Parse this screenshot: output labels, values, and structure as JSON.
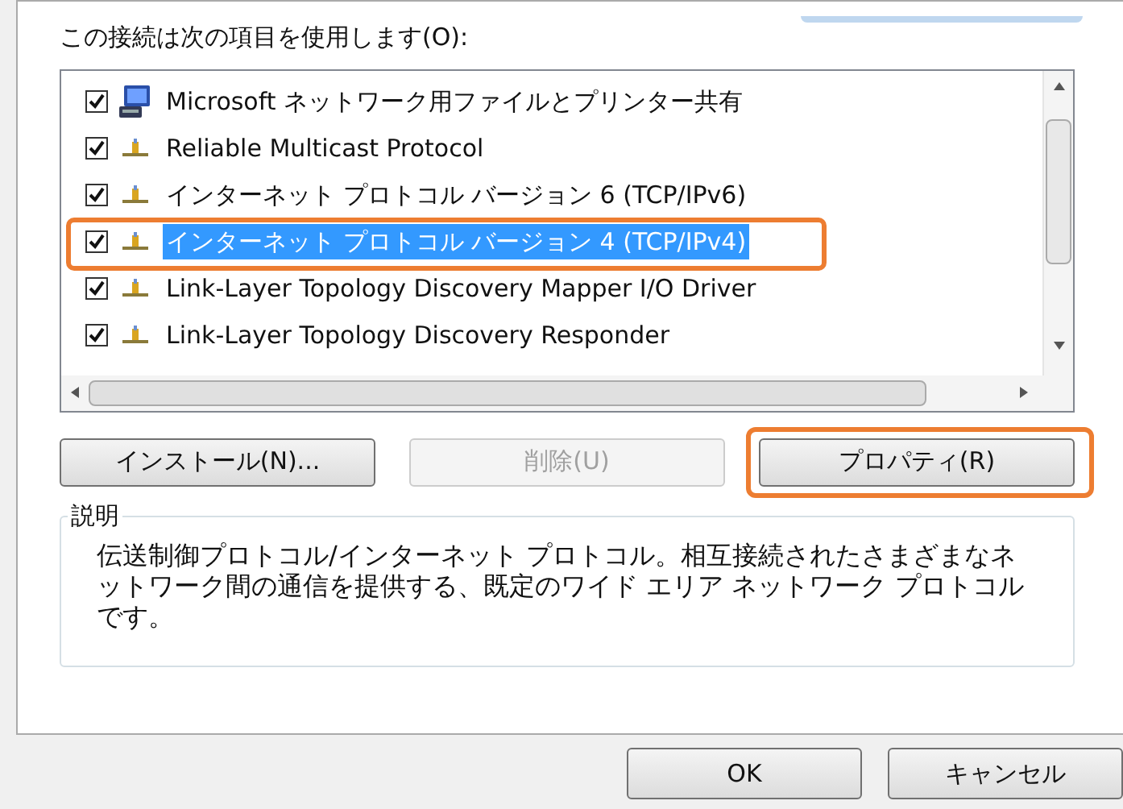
{
  "heading": "この接続は次の項目を使用します(O):",
  "items": [
    {
      "label": "Microsoft ネットワーク用ファイルとプリンター共有",
      "kind": "client",
      "checked": true,
      "selected": false,
      "highlighted": false
    },
    {
      "label": "Reliable Multicast Protocol",
      "kind": "protocol",
      "checked": true,
      "selected": false,
      "highlighted": false
    },
    {
      "label": "インターネット プロトコル バージョン 6 (TCP/IPv6)",
      "kind": "protocol",
      "checked": true,
      "selected": false,
      "highlighted": false
    },
    {
      "label": "インターネット プロトコル バージョン 4 (TCP/IPv4)",
      "kind": "protocol",
      "checked": true,
      "selected": true,
      "highlighted": true
    },
    {
      "label": "Link-Layer Topology Discovery Mapper I/O Driver",
      "kind": "protocol",
      "checked": true,
      "selected": false,
      "highlighted": false
    },
    {
      "label": "Link-Layer Topology Discovery Responder",
      "kind": "protocol",
      "checked": true,
      "selected": false,
      "highlighted": false
    }
  ],
  "buttons": [
    {
      "label": "インストール(N)...",
      "disabled": false,
      "highlighted": false
    },
    {
      "label": "削除(U)",
      "disabled": true,
      "highlighted": false
    },
    {
      "label": "プロパティ(R)",
      "disabled": false,
      "highlighted": true
    }
  ],
  "description": {
    "title": "説明",
    "text": "伝送制御プロトコル/インターネット プロトコル。相互接続されたさまざまなネットワーク間の通信を提供する、既定のワイド エリア ネットワーク プロトコルです。"
  },
  "footer_buttons": [
    "OK",
    "キャンセル"
  ]
}
